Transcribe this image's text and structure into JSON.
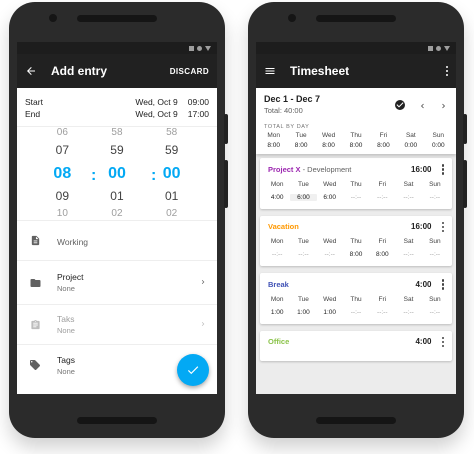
{
  "entry": {
    "title": "Add entry",
    "discard": "DISCARD",
    "start_label": "Start",
    "start_date": "Wed, Oct 9",
    "start_time": "09:00",
    "end_label": "End",
    "end_date": "Wed, Oct 9",
    "end_time": "17:00",
    "picker": {
      "hours": [
        "06",
        "07",
        "08",
        "09",
        "10"
      ],
      "minutes": [
        "58",
        "59",
        "00",
        "01",
        "02"
      ],
      "seconds": [
        "58",
        "59",
        "00",
        "01",
        "02"
      ],
      "separator": ":"
    },
    "rows": [
      {
        "main": "Working",
        "sub": ""
      },
      {
        "main": "Project",
        "sub": "None"
      },
      {
        "main": "Taks",
        "sub": "None"
      },
      {
        "main": "Tags",
        "sub": "None"
      }
    ]
  },
  "timesheet": {
    "title": "Timesheet",
    "range": "Dec 1 - Dec 7",
    "total": "Total: 40:00",
    "section_label": "TOTAL BY DAY",
    "days": [
      "Mon",
      "Tue",
      "Wed",
      "Thu",
      "Fri",
      "Sat",
      "Sun"
    ],
    "totals": [
      "8:00",
      "8:00",
      "8:00",
      "8:00",
      "8:00",
      "0:00",
      "0:00"
    ],
    "cards": [
      {
        "name": "Project X",
        "desc": " - Development",
        "hours": "16:00",
        "values": [
          "4:00",
          "6:00",
          "6:00",
          "--:--",
          "--:--",
          "--:--",
          "--:--"
        ]
      },
      {
        "name": "Vacation",
        "desc": "",
        "hours": "16:00",
        "values": [
          "--:--",
          "--:--",
          "--:--",
          "8:00",
          "8:00",
          "--:--",
          "--:--"
        ]
      },
      {
        "name": "Break",
        "desc": "",
        "hours": "4:00",
        "values": [
          "1:00",
          "1:00",
          "1:00",
          "--:--",
          "--:--",
          "--:--",
          "--:--"
        ]
      },
      {
        "name": "Office",
        "desc": "",
        "hours": "4:00",
        "values": [],
        "days_hidden": true
      }
    ]
  },
  "colors": {
    "accent": "#03a9f4",
    "project_x": "#9c27b0",
    "vacation": "#ff9800",
    "break": "#3f51b5",
    "office": "#8bc34a"
  }
}
